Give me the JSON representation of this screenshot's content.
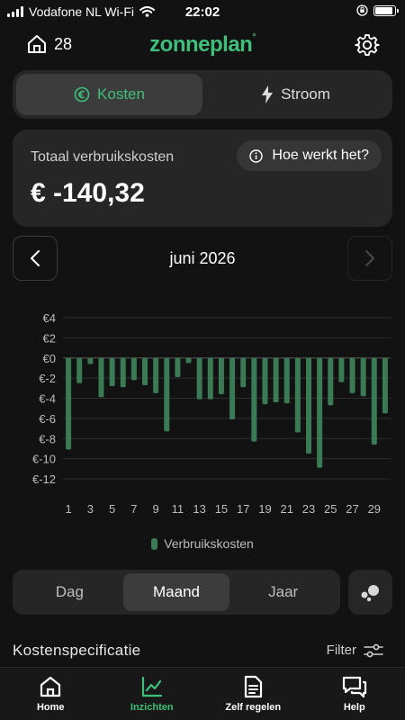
{
  "status_bar": {
    "carrier": "Vodafone NL Wi-Fi",
    "time": "22:02"
  },
  "header": {
    "home_count": "28",
    "brand": "zonneplan",
    "brand_dot": "°"
  },
  "top_tabs": [
    {
      "label": "Kosten",
      "icon": "euro-circle-icon",
      "active": true
    },
    {
      "label": "Stroom",
      "icon": "lightning-icon",
      "active": false
    }
  ],
  "total_card": {
    "label": "Totaal verbruikskosten",
    "value": "€ -140,32",
    "help_label": "Hoe werkt het?"
  },
  "month_nav": {
    "label": "juni 2026"
  },
  "chart_data": {
    "type": "bar",
    "categories": [
      "1",
      "2",
      "3",
      "4",
      "5",
      "6",
      "7",
      "8",
      "9",
      "10",
      "11",
      "12",
      "13",
      "14",
      "15",
      "16",
      "17",
      "18",
      "19",
      "20",
      "21",
      "22",
      "23",
      "24",
      "25",
      "26",
      "27",
      "28",
      "29",
      "30"
    ],
    "x_tick_labels": [
      "1",
      "3",
      "5",
      "7",
      "9",
      "11",
      "13",
      "15",
      "17",
      "19",
      "21",
      "23",
      "25",
      "27",
      "29"
    ],
    "series": [
      {
        "name": "Verbruikskosten",
        "values": [
          -9.1,
          -2.5,
          -0.6,
          -3.9,
          -2.8,
          -2.9,
          -2.2,
          -2.7,
          -3.5,
          -7.3,
          -1.9,
          -0.5,
          -4.1,
          -4.1,
          -3.6,
          -6.1,
          -2.9,
          -8.3,
          -4.6,
          -4.4,
          -4.5,
          -7.4,
          -9.5,
          -10.9,
          -4.7,
          -2.4,
          -3.5,
          -3.8,
          -8.6,
          -5.5
        ]
      }
    ],
    "y_ticks": [
      4,
      2,
      0,
      -2,
      -4,
      -6,
      -8,
      -10,
      -12
    ],
    "y_tick_labels": [
      "€4",
      "€2",
      "€0",
      "€-2",
      "€-4",
      "€-6",
      "€-8",
      "€-10",
      "€-12"
    ],
    "ylim": [
      -12,
      4
    ],
    "grid": true,
    "legend_position": "bottom-center",
    "bar_color": "#3a7a55"
  },
  "legend": {
    "label": "Verbruikskosten"
  },
  "period_tabs": [
    {
      "label": "Dag",
      "active": false
    },
    {
      "label": "Maand",
      "active": true
    },
    {
      "label": "Jaar",
      "active": false
    }
  ],
  "section": {
    "title": "Kostenspecificatie",
    "filter_label": "Filter"
  },
  "bottom_tabs": [
    {
      "label": "Home",
      "icon": "home-icon",
      "active": false
    },
    {
      "label": "Inzichten",
      "icon": "chart-line-icon",
      "active": true
    },
    {
      "label": "Zelf regelen",
      "icon": "document-icon",
      "active": false
    },
    {
      "label": "Help",
      "icon": "chat-icon",
      "active": false
    }
  ],
  "colors": {
    "accent": "#3fbf7a",
    "background": "#121212",
    "card": "#262626",
    "bar": "#3a7a55"
  }
}
